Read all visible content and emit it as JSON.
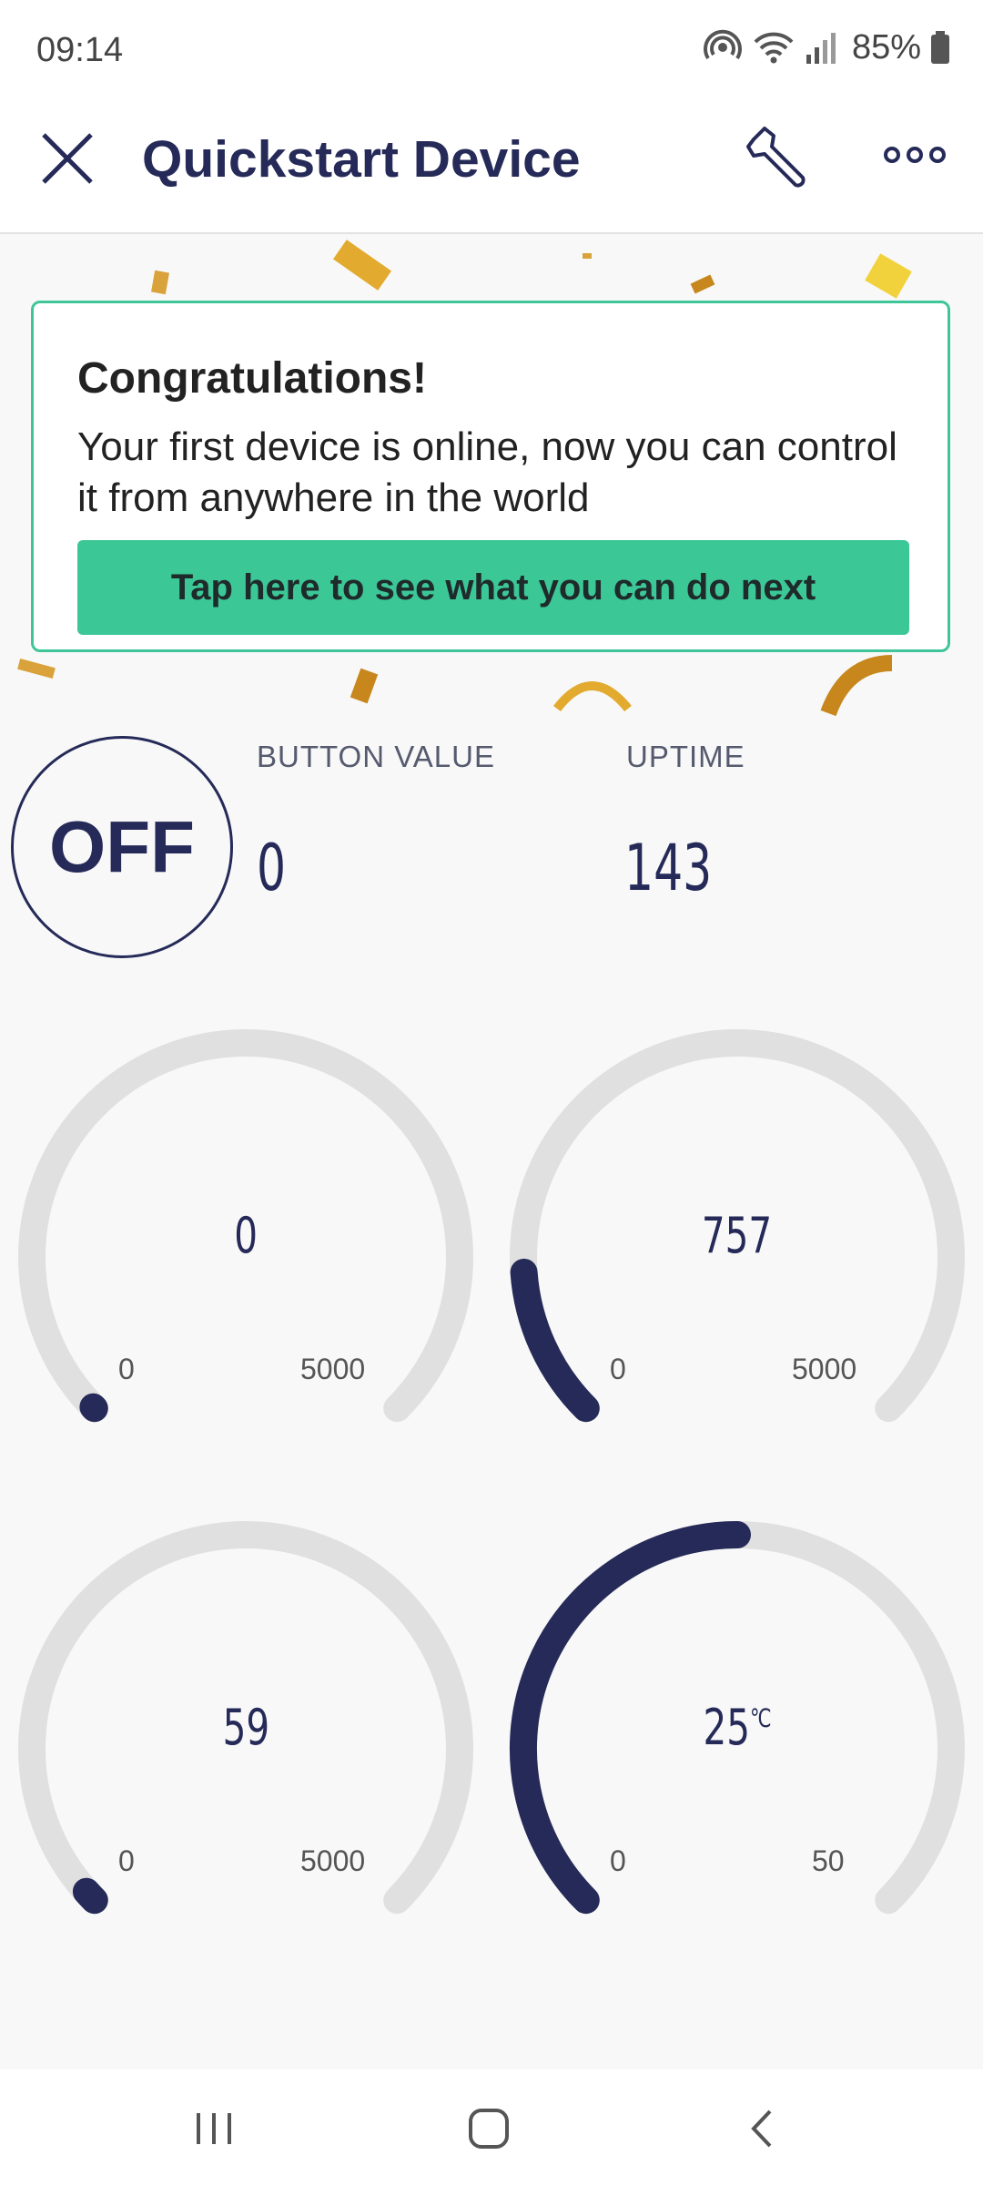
{
  "status_bar": {
    "time": "09:14",
    "battery": "85%"
  },
  "app_bar": {
    "title": "Quickstart Device"
  },
  "banner": {
    "title": "Congratulations!",
    "body": "Your first device is online, now you can control it from anywhere in the world",
    "cta": "Tap here to see what you can do next"
  },
  "switch": {
    "label": "OFF"
  },
  "button_value": {
    "label": "BUTTON VALUE",
    "value": "0"
  },
  "uptime": {
    "label": "UPTIME",
    "value": "143"
  },
  "gauges": [
    {
      "value": "0",
      "unit": "",
      "min": "0",
      "max": "5000",
      "fill": 0
    },
    {
      "value": "757",
      "unit": "",
      "min": "0",
      "max": "5000",
      "fill": 0.1514
    },
    {
      "value": "59",
      "unit": "",
      "min": "0",
      "max": "5000",
      "fill": 0.0118
    },
    {
      "value": "25",
      "unit": "℃",
      "min": "0",
      "max": "50",
      "fill": 0.5
    }
  ],
  "colors": {
    "accent": "#3cc797",
    "primary": "#252a58",
    "track": "#e0e0e0"
  },
  "icons": {
    "close": "close-icon",
    "wrench": "wrench-icon",
    "more": "more-icon",
    "nav_recents": "recents-icon",
    "nav_home": "home-icon",
    "nav_back": "back-icon"
  }
}
